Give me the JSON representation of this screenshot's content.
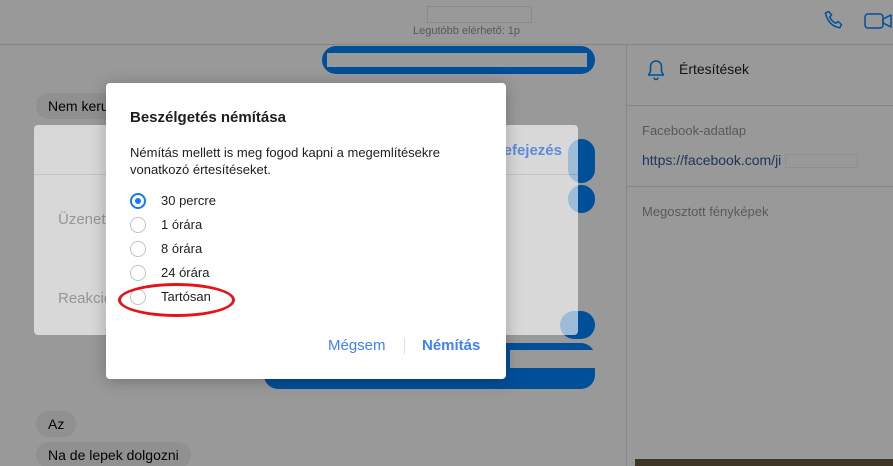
{
  "header": {
    "last_active": "Legutóbb elérhető: 1p",
    "call_icon": "phone-icon",
    "video_icon": "video-camera-icon"
  },
  "chat": {
    "messages_left": [
      "Nem keru",
      "Az",
      "Na de lepek dolgozni"
    ]
  },
  "right_panel": {
    "notifications_label": "Értesítések",
    "profile_section_title": "Facebook-adatlap",
    "profile_link": "https://facebook.com/ji",
    "shared_photos_title": "Megosztott fényképek"
  },
  "settings_popup": {
    "done_label": "Befejezés",
    "row_message": "Üzenet",
    "row_reaction": "Reakció"
  },
  "mute_dialog": {
    "title": "Beszélgetés némítása",
    "description": "Némítás mellett is meg fogod kapni a megemlítésekre vonatkozó értesítéseket.",
    "options": [
      {
        "label": "30 percre",
        "selected": true
      },
      {
        "label": "1 órára",
        "selected": false
      },
      {
        "label": "8 órára",
        "selected": false
      },
      {
        "label": "24 órára",
        "selected": false
      },
      {
        "label": "Tartósan",
        "selected": false
      }
    ],
    "cancel_label": "Mégsem",
    "mute_label": "Némítás"
  },
  "colors": {
    "accent": "#4080ff",
    "radio_selected": "#1877f2",
    "annotation": "#e3141b",
    "message_blue": "#0084ff"
  }
}
